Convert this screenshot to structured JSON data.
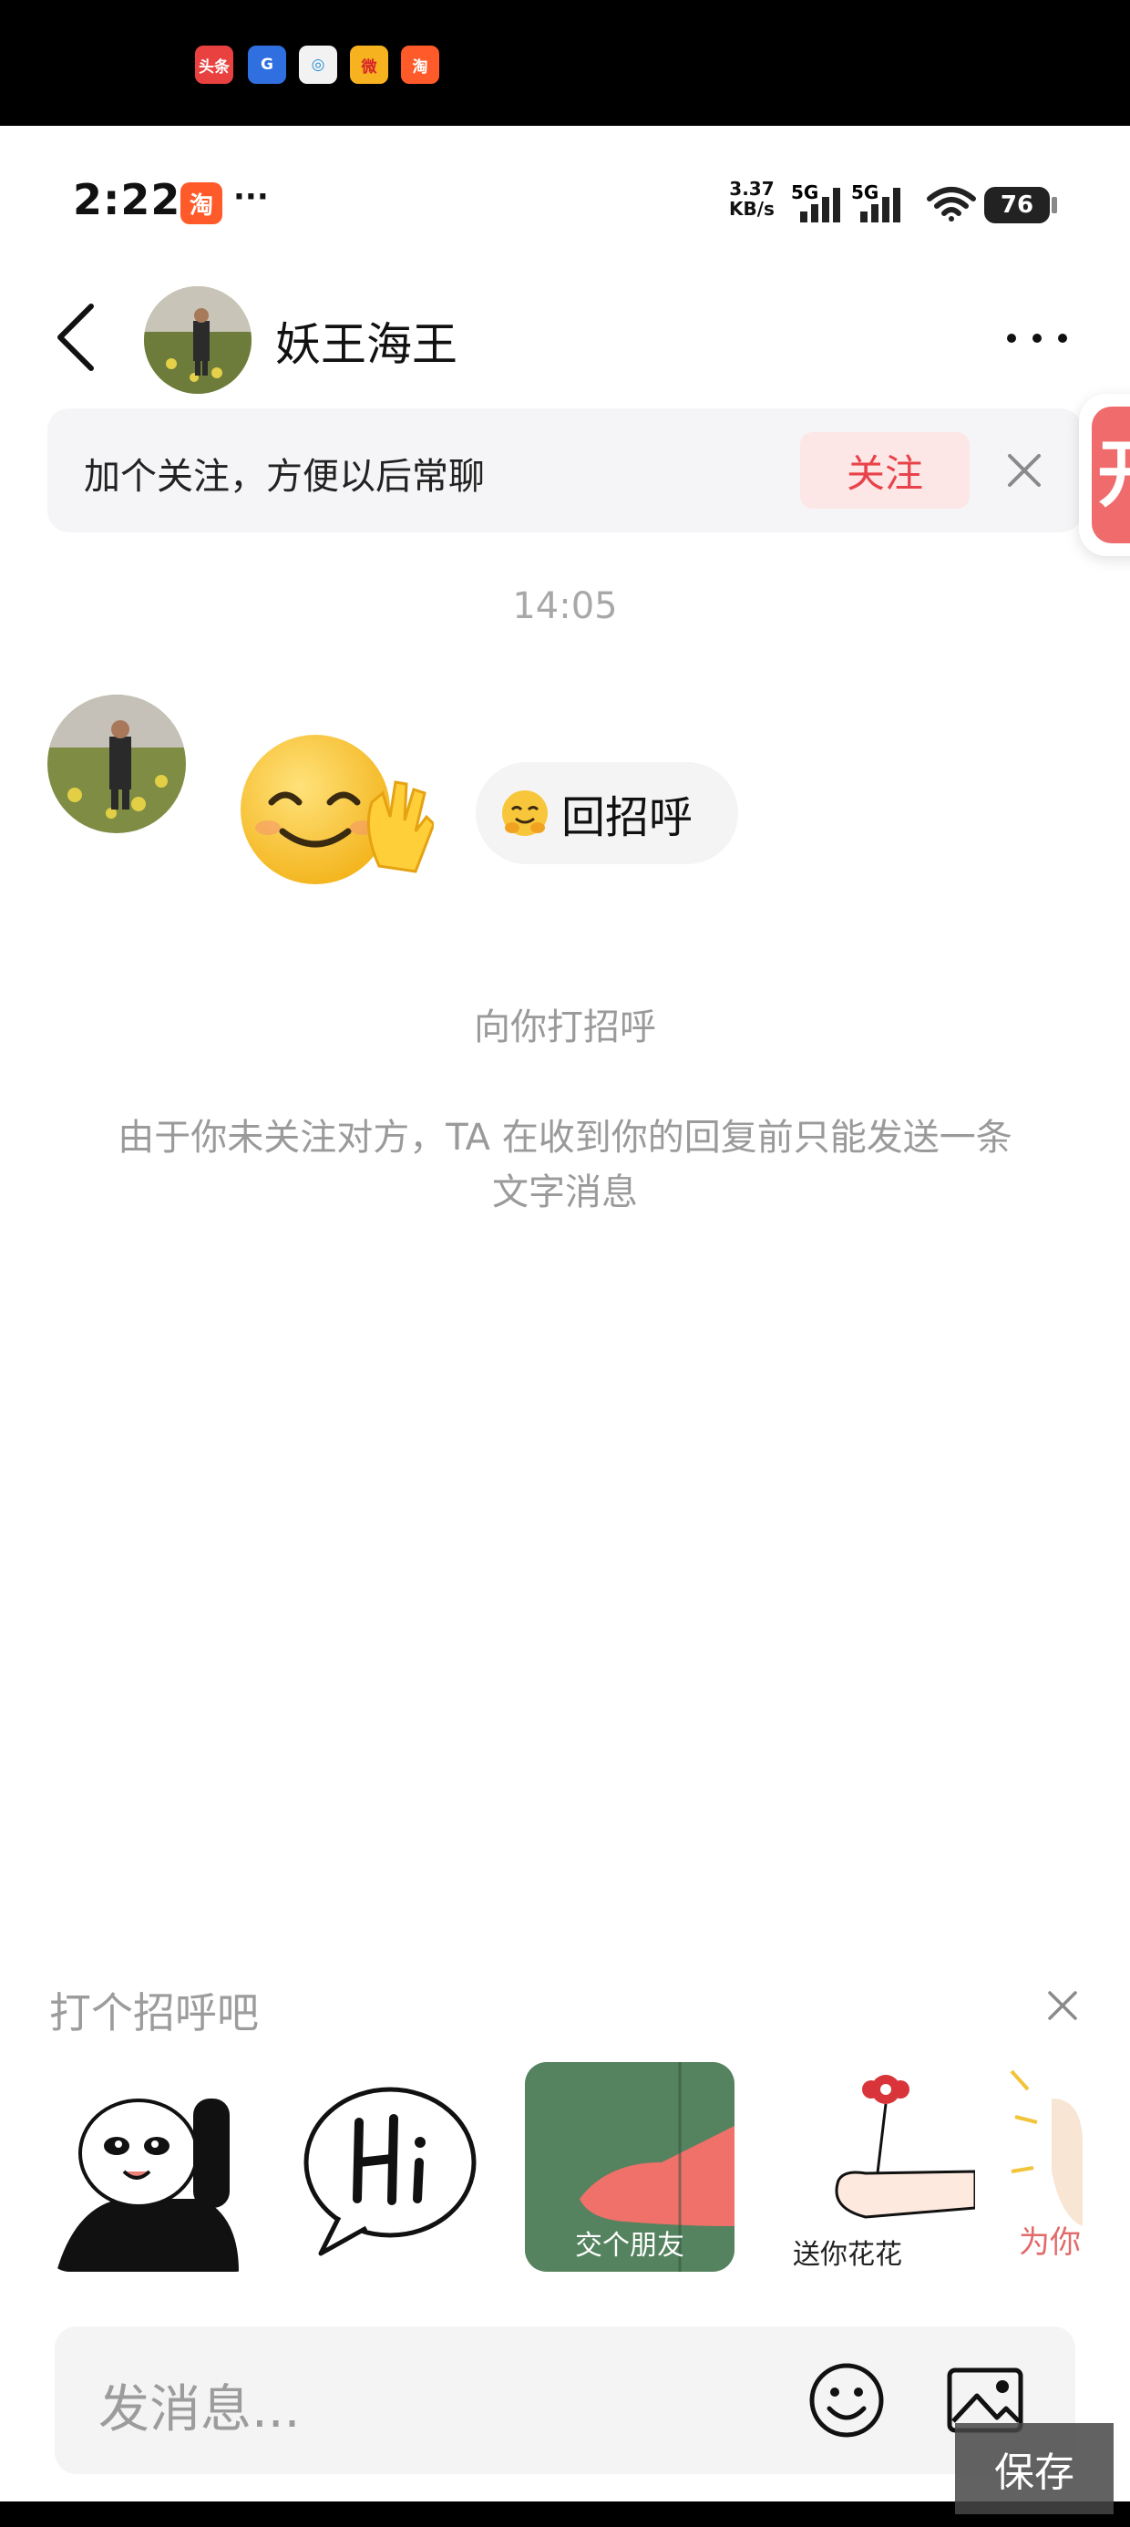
{
  "status_bar": {
    "time": "2:22",
    "app_badge": "淘",
    "more": "···",
    "net_speed_value": "3.37",
    "net_speed_unit": "KB/s",
    "signal_1": "5G",
    "signal_2": "5G",
    "battery": "76"
  },
  "top_apps": [
    {
      "label": "头条",
      "color": "#e94040"
    },
    {
      "label": "G",
      "color": "#2f6fe0"
    },
    {
      "label": "◎",
      "color": "#f2f2f2"
    },
    {
      "label": "微",
      "color": "#f6b21f"
    },
    {
      "label": "淘",
      "color": "#ff5a2a"
    }
  ],
  "header": {
    "contact_name": "妖王海王",
    "back_icon": "chevron-left-icon",
    "more_icon": "more-horizontal-icon"
  },
  "follow_banner": {
    "text": "加个关注，方便以后常聊",
    "button_label": "关注",
    "close_icon": "close-icon",
    "accent": "#e8434a"
  },
  "side_tab": {
    "glyph": "开"
  },
  "chat": {
    "timestamp": "14:05",
    "reply_chip_label": "回招呼",
    "greeting_note": "向你打招呼",
    "limit_note": "由于你未关注对方，TA 在收到你的回复前只能发送一条文字消息"
  },
  "greet_panel": {
    "title": "打个招呼吧",
    "close_icon": "close-icon",
    "stickers": [
      {
        "name": "panda-wave",
        "caption": ""
      },
      {
        "name": "hi-bubble",
        "caption": ""
      },
      {
        "name": "make-friends",
        "caption": "交个朋友"
      },
      {
        "name": "send-flower",
        "caption": "送你花花"
      },
      {
        "name": "for-you",
        "caption": "为你"
      }
    ]
  },
  "input_bar": {
    "placeholder": "发消息...",
    "emoji_icon": "smiley-icon",
    "image_icon": "image-icon"
  },
  "overlay": {
    "save_label": "保存"
  }
}
